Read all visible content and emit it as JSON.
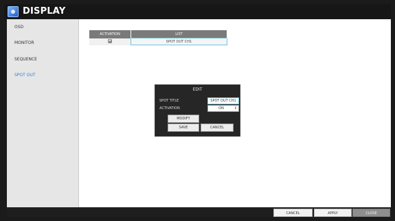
{
  "window": {
    "title": "DISPLAY"
  },
  "sidebar": {
    "items": [
      {
        "label": "OSD"
      },
      {
        "label": "MONITOR"
      },
      {
        "label": "SEQUENCE"
      },
      {
        "label": "SPOT OUT",
        "active": true
      }
    ]
  },
  "table": {
    "headers": {
      "activation": "ACTIVATION",
      "list": "LIST"
    },
    "rows": [
      {
        "activation_checked": true,
        "list": "SPOT OUT CH1"
      }
    ]
  },
  "dialog": {
    "title": "EDIT",
    "spot_title_label": "SPOT TITLE",
    "spot_title_value": "SPOT OUT CH1",
    "activation_label": "ACTIVATION",
    "activation_value": "ON",
    "modify_label": "MODIFY",
    "save_label": "SAVE",
    "cancel_label": "CANCEL"
  },
  "footer": {
    "cancel_label": "CANCEL",
    "apply_label": "APPLY",
    "close_label": "CLOSE"
  },
  "colors": {
    "accent": "#2f7fd4",
    "highlight_border": "#6fc6d9",
    "header_gray": "#7a7a7a"
  }
}
